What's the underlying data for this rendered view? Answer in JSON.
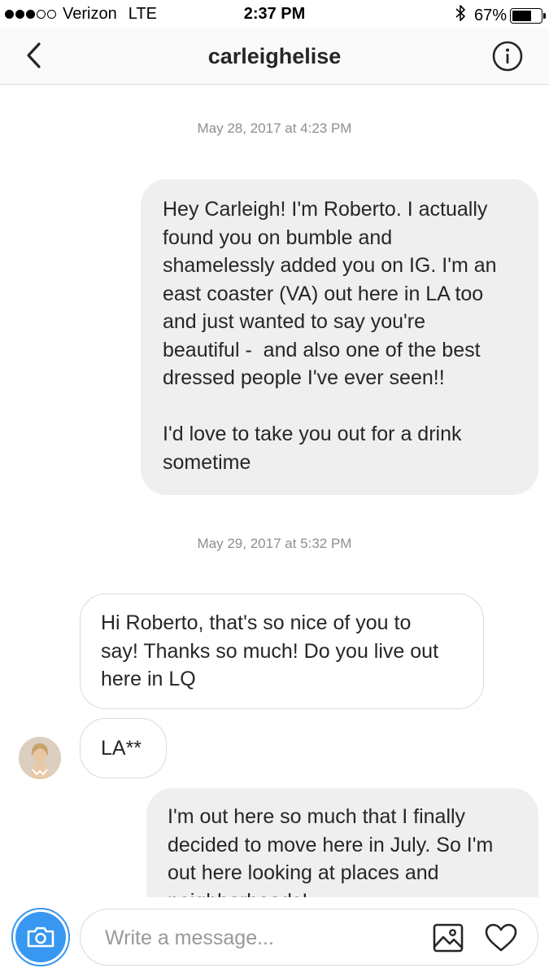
{
  "status_bar": {
    "signal_bars_filled": 3,
    "signal_bars_total": 5,
    "carrier": "Verizon",
    "network": "LTE",
    "time": "2:37 PM",
    "battery_percent": "67%",
    "battery_level": 0.67
  },
  "nav": {
    "back_icon": "chevron-left-icon",
    "title": "carleighelise",
    "info_icon": "info-icon"
  },
  "conversation": {
    "timestamp_1": "May 28, 2017 at 4:23 PM",
    "sent_message_1": "Hey Carleigh! I'm Roberto. I actually\nfound you on bumble and\nshamelessly added you on IG. I'm an\neast coaster (VA) out here in LA too\nand just wanted to say you're\nbeautiful -  and also one of the best\ndressed people I've ever seen!!\n\nI'd love to take you out for a drink\nsometime",
    "timestamp_2": "May 29, 2017 at 5:32 PM",
    "received_message_1": "Hi Roberto, that's so nice of you to\nsay! Thanks so much! Do you live out\nhere in LQ",
    "received_message_2": "LA**",
    "sent_message_2": "I'm out here so much that I finally\ndecided to move here in July. So I'm\nout here looking at places and\nneighborhoods!"
  },
  "composer": {
    "camera_icon": "camera-icon",
    "placeholder": "Write a message...",
    "gallery_icon": "image-icon",
    "heart_icon": "heart-icon"
  },
  "colors": {
    "accent_blue": "#3897f0",
    "sent_bubble": "#efefef",
    "border": "#dbdbdb",
    "timestamp_gray": "#8e8e8e"
  }
}
